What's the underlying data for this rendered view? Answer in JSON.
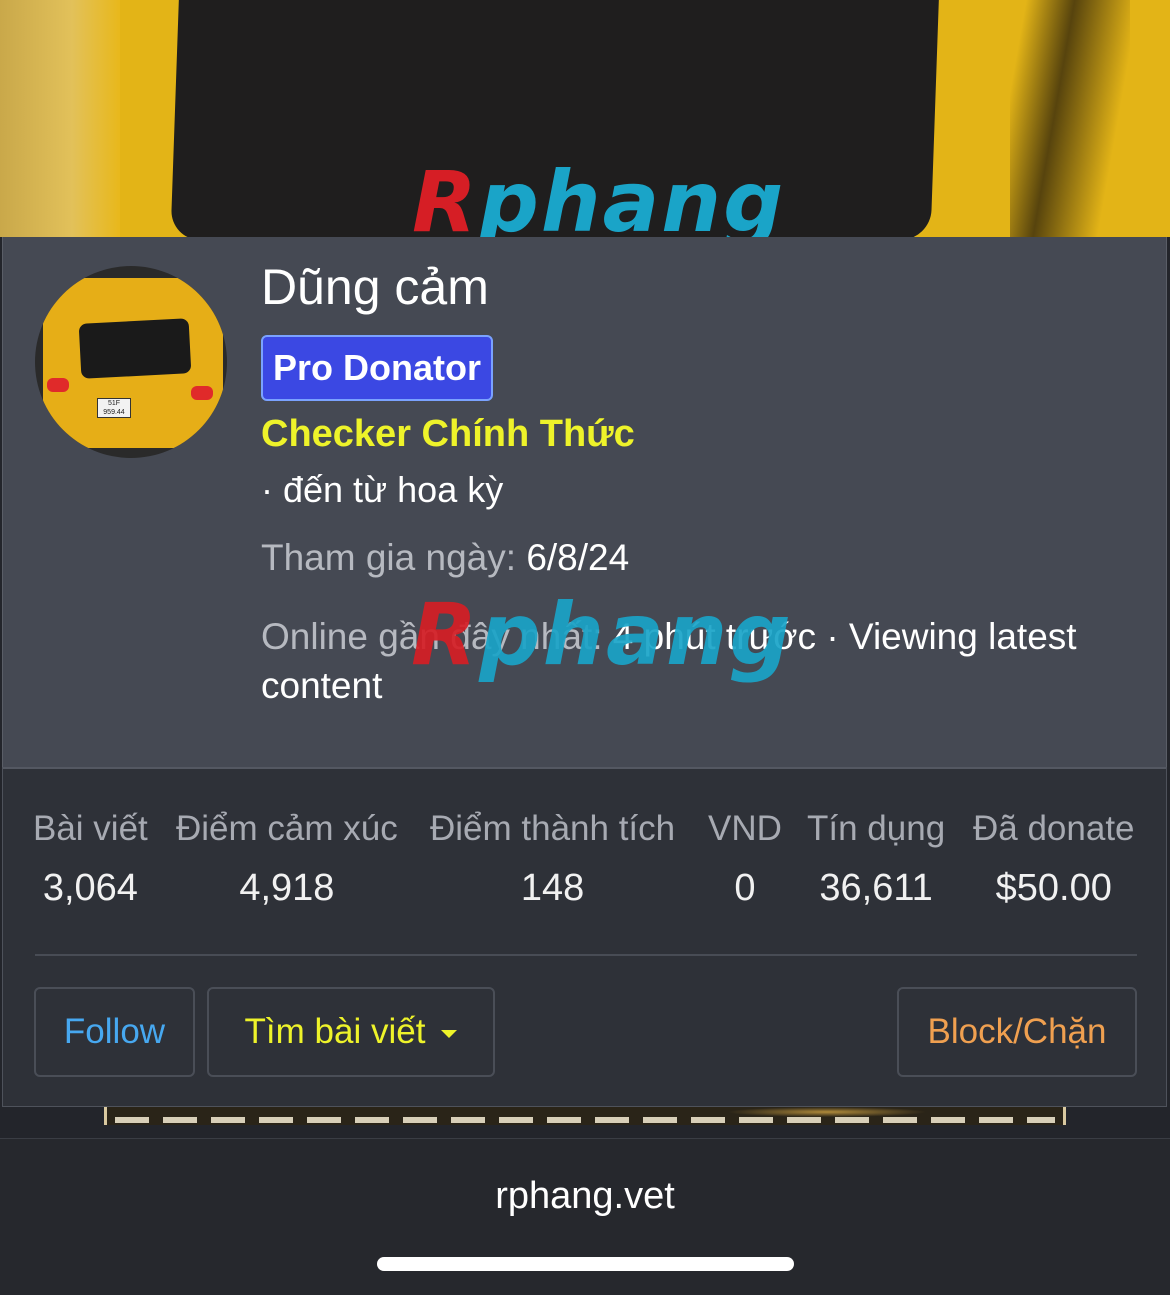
{
  "cover": {
    "logo_initial": "R",
    "logo_rest": "phang"
  },
  "profile": {
    "name": "Dũng cảm",
    "badge": "Pro Donator",
    "role": "Checker Chính Thức",
    "location": "· đến từ hoa kỳ",
    "joined_label": "Tham gia ngày:",
    "joined_value": "6/8/24",
    "online_label": "Online gần đây nhất:",
    "online_value": "4 phút trước · Viewing latest content",
    "avatar_plate_line1": "51F",
    "avatar_plate_line2": "959.44",
    "watermark_initial": "R",
    "watermark_rest": "phang"
  },
  "stats": [
    {
      "label": "Bài viết",
      "value": "3,064"
    },
    {
      "label": "Điểm cảm xúc",
      "value": "4,918"
    },
    {
      "label": "Điểm thành tích",
      "value": "148"
    },
    {
      "label": "VND",
      "value": "0"
    },
    {
      "label": "Tín dụng",
      "value": "36,611"
    },
    {
      "label": "Đã donate",
      "value": "$50.00"
    }
  ],
  "actions": {
    "follow": "Follow",
    "find_posts": "Tìm bài viết",
    "block": "Block/Chặn"
  },
  "browser": {
    "url": "rphang.vet"
  },
  "colors": {
    "panel": "#454953",
    "stats_panel": "#2e3138",
    "badge": "#3b48e3",
    "role": "#eef32a",
    "follow": "#47a8f0",
    "block": "#f0a050"
  },
  "icons": {
    "find_posts_dropdown": "caret-down-icon"
  }
}
